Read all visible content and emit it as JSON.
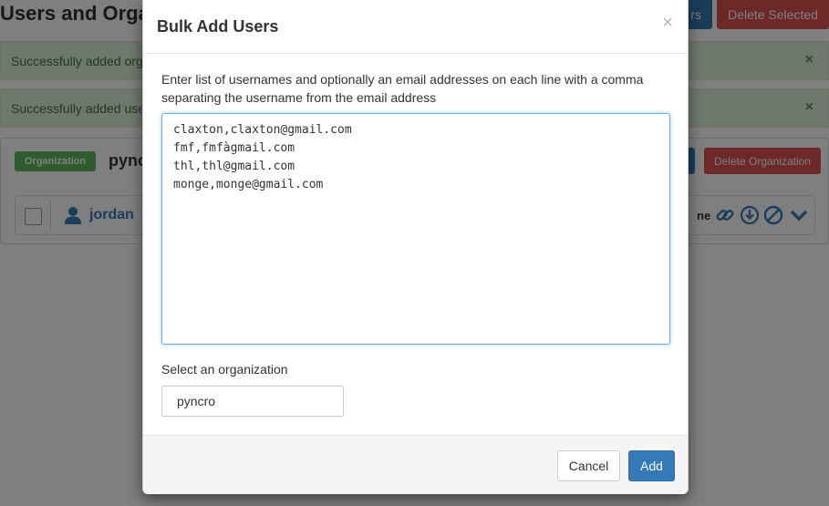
{
  "page": {
    "title": "Users and Orga",
    "top_buttons": {
      "partial_blue_label": "rs",
      "delete_selected_label": "Delete Selected"
    },
    "alerts": [
      {
        "text": "Successfully added org"
      },
      {
        "text": "Successfully added use"
      }
    ],
    "organization_panel": {
      "label": "Organization",
      "name": "pync",
      "delete_button_label": "Delete Organization",
      "user": {
        "name": "jordan",
        "role_partial": "ne"
      },
      "action_icons": [
        "link-icon",
        "download-icon",
        "ban-icon",
        "chevron-down-icon"
      ]
    },
    "colors": {
      "primary": "#337ab7",
      "danger": "#d9534f",
      "success": "#5cb85c",
      "alert_bg": "#dff0d8",
      "alert_text": "#3c763d"
    }
  },
  "modal": {
    "title": "Bulk Add Users",
    "close_symbol": "×",
    "description": "Enter list of usernames and optionally an email addresses on each line with a comma separating the username from the email address",
    "textarea_lines": [
      "claxton,claxton@gmail.com",
      "fmf,fmfàgmail.com",
      "thl,thl@gmail.com",
      "monge,monge@gmail.com"
    ],
    "select_label": "Select an organization",
    "selected_organization": "pyncro",
    "cancel_label": "Cancel",
    "add_label": "Add"
  }
}
